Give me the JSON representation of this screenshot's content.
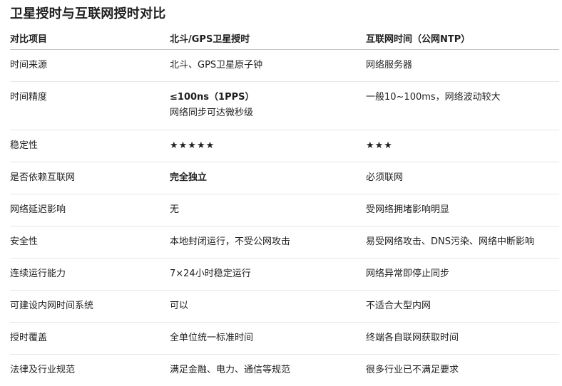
{
  "title": "卫星授时与互联网授时对比",
  "table": {
    "headers": [
      "对比项目",
      "北斗/GPS卫星授时",
      "互联网时间（公网NTP）"
    ],
    "rows": [
      {
        "item": "时间来源",
        "satellite": "北斗、GPS卫星原子钟",
        "internet": "网络服务器"
      },
      {
        "item": "时间精度",
        "satellite": "≤100ns（1PPS）",
        "satellite_note": "网络同步可达微秒级",
        "internet": "一般10~100ms，网络波动较大"
      },
      {
        "item": "稳定性",
        "satellite": "★★★★★",
        "internet": "★★★"
      },
      {
        "item": "是否依赖互联网",
        "satellite": "完全独立",
        "internet": "必须联网"
      },
      {
        "item": "网络延迟影响",
        "satellite": "无",
        "internet": "受网络拥堵影响明显"
      },
      {
        "item": "安全性",
        "satellite": "本地封闭运行，不受公网攻击",
        "internet": "易受网络攻击、DNS污染、网络中断影响"
      },
      {
        "item": "连续运行能力",
        "satellite": "7×24小时稳定运行",
        "internet": "网络异常即停止同步"
      },
      {
        "item": "可建设内网时间系统",
        "satellite": "可以",
        "internet": "不适合大型内网"
      },
      {
        "item": "授时覆盖",
        "satellite": "全单位统一标准时间",
        "internet": "终端各自联网获取时间"
      },
      {
        "item": "法律及行业规范",
        "satellite": "满足金融、电力、通信等规范",
        "internet": "很多行业已不满足要求"
      }
    ]
  }
}
